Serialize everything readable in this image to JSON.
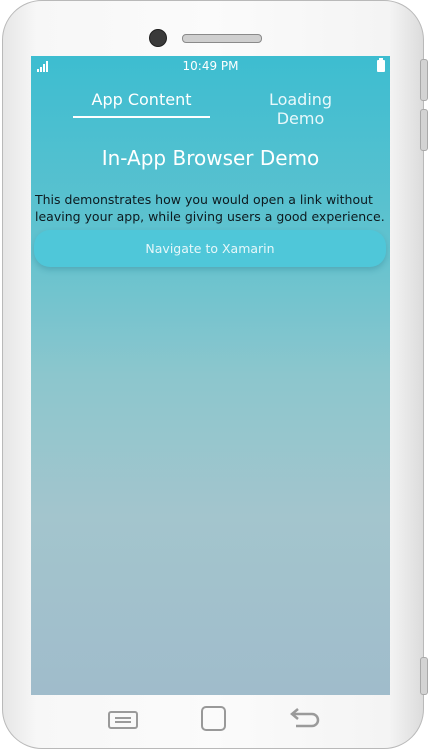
{
  "status_bar": {
    "time": "10:49 PM",
    "signal_icon": "signal-icon",
    "battery_icon": "battery-icon"
  },
  "tabs": [
    {
      "label": "App Content",
      "active": true
    },
    {
      "label": "Loading Demo",
      "active": false
    }
  ],
  "page": {
    "title": "In-App Browser Demo",
    "description": "This demonstrates how you would open a link without leaving your app, while giving users a good experience.",
    "button_label": "Navigate to Xamarin"
  },
  "colors": {
    "accent": "#3dbdd0",
    "button": "#4fc7d9",
    "gradient_bottom": "#a0bccb"
  },
  "device_nav": {
    "menu_icon": "menu-icon",
    "home_icon": "home-icon",
    "back_icon": "back-icon"
  }
}
